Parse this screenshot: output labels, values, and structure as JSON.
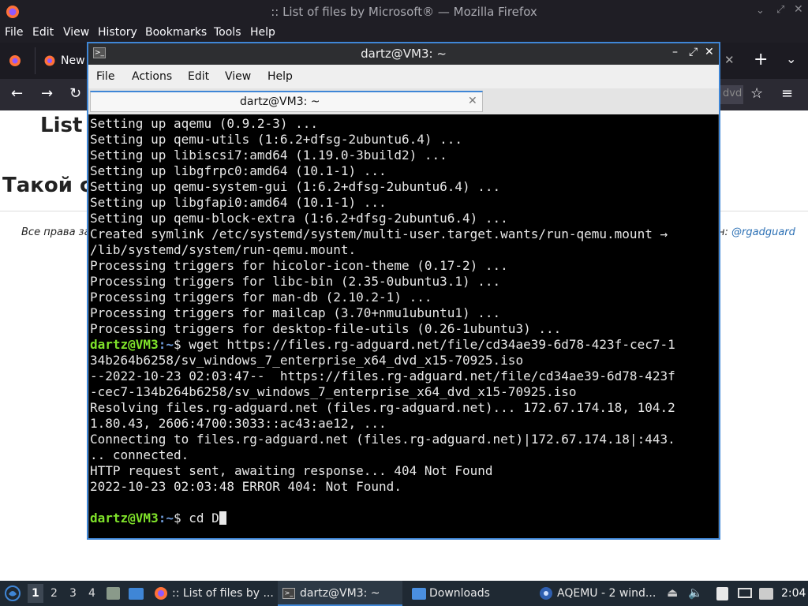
{
  "firefox": {
    "window_title": ":: List of files by Microsoft® — Mozilla Firefox",
    "menu": [
      "File",
      "Edit",
      "View",
      "History",
      "Bookmarks",
      "Tools",
      "Help"
    ],
    "tab_label": "New",
    "url_fragment": "dvd"
  },
  "page": {
    "heading": "List o",
    "subheading": "Такой ст",
    "footer_left": "Все права за",
    "footer_right": "н: ",
    "footer_link": "@rgadguard"
  },
  "terminal": {
    "title": "dartz@VM3: ~",
    "menu": [
      "File",
      "Actions",
      "Edit",
      "View",
      "Help"
    ],
    "tab_title": "dartz@VM3: ~",
    "prompt_user": "dartz@VM3",
    "prompt_path": ":~",
    "prompt_symbol": "$",
    "lines_before_cmd": [
      "Setting up aqemu (0.9.2-3) ...",
      "Setting up qemu-utils (1:6.2+dfsg-2ubuntu6.4) ...",
      "Setting up libiscsi7:amd64 (1.19.0-3build2) ...",
      "Setting up libgfrpc0:amd64 (10.1-1) ...",
      "Setting up qemu-system-gui (1:6.2+dfsg-2ubuntu6.4) ...",
      "Setting up libgfapi0:amd64 (10.1-1) ...",
      "Setting up qemu-block-extra (1:6.2+dfsg-2ubuntu6.4) ...",
      "Created symlink /etc/systemd/system/multi-user.target.wants/run-qemu.mount →",
      "/lib/systemd/system/run-qemu.mount.",
      "Processing triggers for hicolor-icon-theme (0.17-2) ...",
      "Processing triggers for libc-bin (2.35-0ubuntu3.1) ...",
      "Processing triggers for man-db (2.10.2-1) ...",
      "Processing triggers for mailcap (3.70+nmu1ubuntu1) ...",
      "Processing triggers for desktop-file-utils (0.26-1ubuntu3) ..."
    ],
    "cmd1": " wget https://files.rg-adguard.net/file/cd34ae39-6d78-423f-cec7-1",
    "cmd1_cont": "34b264b6258/sv_windows_7_enterprise_x64_dvd_x15-70925.iso",
    "output": [
      "--2022-10-23 02:03:47--  https://files.rg-adguard.net/file/cd34ae39-6d78-423f",
      "-cec7-134b264b6258/sv_windows_7_enterprise_x64_dvd_x15-70925.iso",
      "Resolving files.rg-adguard.net (files.rg-adguard.net)... 172.67.174.18, 104.2",
      "1.80.43, 2606:4700:3033::ac43:ae12, ...",
      "Connecting to files.rg-adguard.net (files.rg-adguard.net)|172.67.174.18|:443.",
      ".. connected.",
      "HTTP request sent, awaiting response... 404 Not Found",
      "2022-10-23 02:03:48 ERROR 404: Not Found.",
      ""
    ],
    "cmd2": " cd D"
  },
  "taskbar": {
    "workspaces": [
      "1",
      "2",
      "3",
      "4"
    ],
    "tasks": [
      ":: List of files by ...",
      "dartz@VM3: ~",
      "Downloads",
      "AQEMU - 2 wind..."
    ],
    "clock": "2:04"
  }
}
